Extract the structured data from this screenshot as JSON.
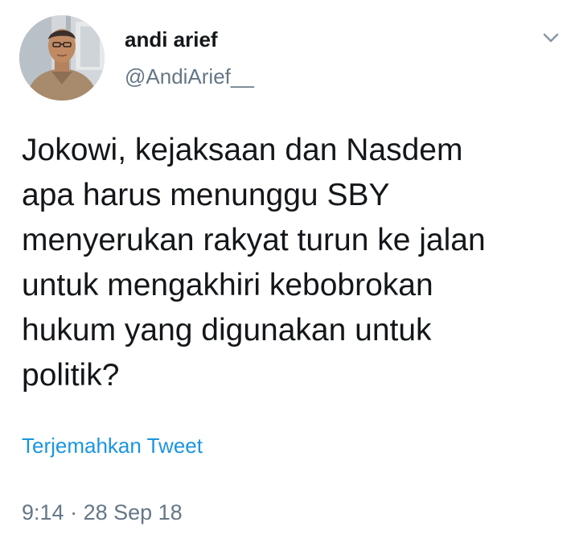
{
  "author": {
    "display_name": "andi arief",
    "handle": "@AndiArief__"
  },
  "tweet": {
    "lines": [
      "Jokowi, kejaksaan dan Nasdem",
      "apa harus menunggu SBY",
      "menyerukan rakyat turun ke jalan",
      "untuk mengakhiri kebobrokan",
      "hukum yang digunakan untuk",
      "politik?"
    ],
    "translate_label": "Terjemahkan Tweet",
    "time": "9:14",
    "separator": "·",
    "date": "28 Sep 18"
  },
  "icons": {
    "menu": "chevron-down-icon",
    "avatar": "profile-photo"
  },
  "colors": {
    "text": "#14171a",
    "secondary": "#657786",
    "link": "#1b95e0",
    "background": "#ffffff"
  }
}
